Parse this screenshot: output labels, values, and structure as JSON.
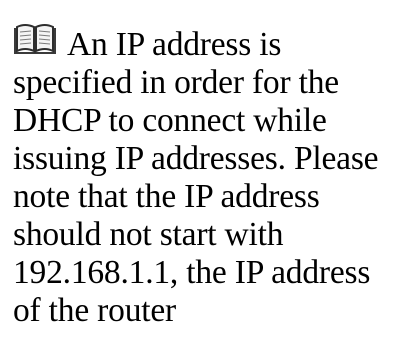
{
  "note": {
    "icon": "book-icon",
    "text": "An IP address is specified in order for the DHCP to connect while issuing IP addresses. Please note that the IP address should not start with 192.168.1.1, the IP address of the router"
  }
}
